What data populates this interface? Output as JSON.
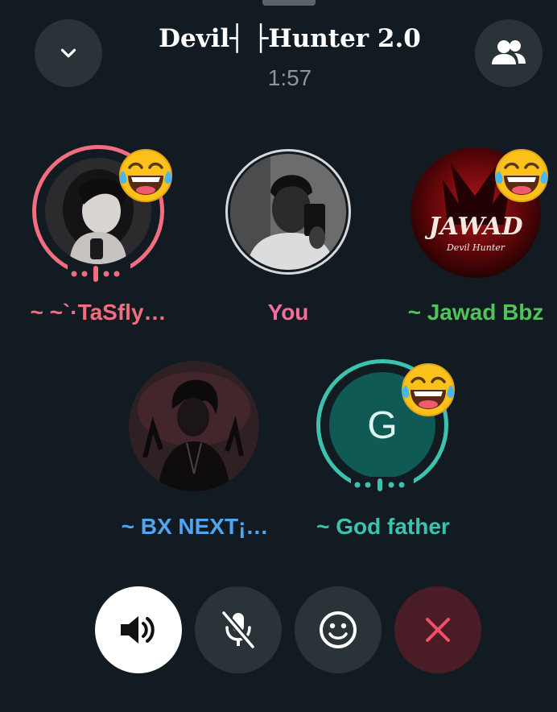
{
  "header": {
    "title": "Devil┤ ├Hunter 2.0",
    "timer": "1:57"
  },
  "icons": {
    "minimize": "chevron-down-icon",
    "participants": "people-icon",
    "speaker": "speaker-icon",
    "mute": "mic-off-icon",
    "reaction": "smiley-icon",
    "end": "close-icon"
  },
  "participants": [
    {
      "name": "~ ~`·TaSfly…",
      "color": "#f26d7d",
      "reaction": "😂",
      "speaking": true
    },
    {
      "name": "You",
      "color": "#f26d9b"
    },
    {
      "name": "~ Jawad Bbz",
      "color": "#4fc45b",
      "reaction": "😂",
      "avatar_text": [
        "JAWAD",
        "Devil Hunter"
      ]
    },
    {
      "name": "~ BX NEXT¡…",
      "color": "#53a5f0"
    },
    {
      "name": "~ God father",
      "color": "#3ec2b0",
      "reaction": "😂",
      "initial": "G",
      "speaking": true
    }
  ],
  "colors": {
    "background": "#121b22",
    "button": "#2a3338",
    "end_call_bg": "#4a1c25",
    "end_call_icon": "#f2506a",
    "speaker_active_bg": "#ffffff"
  }
}
